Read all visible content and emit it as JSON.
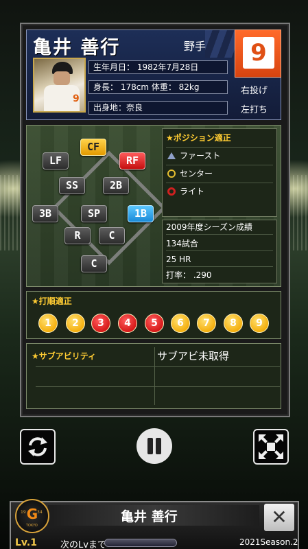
{
  "player": {
    "name": "亀井 善行",
    "position": "野手",
    "number": "9",
    "throws": "右投げ",
    "bats": "左打ち",
    "birthday": "生年月日： 1982年7月28日",
    "body": "身長： 178cm 体重： 82kg",
    "hometown": "出身地：奈良"
  },
  "field_positions": {
    "cf": "CF",
    "lf": "LF",
    "rf": "RF",
    "ss": "SS",
    "b2": "2B",
    "b3": "3B",
    "sp": "SP",
    "b1": "1B",
    "rp": "R",
    "cp": "C",
    "c": "C"
  },
  "aptitude": {
    "title": "★ポジション適正",
    "items": [
      {
        "mark": "triangle-icon",
        "label": "ファースト"
      },
      {
        "mark": "circle-yellow-icon",
        "label": "センター"
      },
      {
        "mark": "circle-red-icon",
        "label": "ライト"
      }
    ]
  },
  "season": {
    "title": "2009年度シーズン成績",
    "games": "134試合",
    "hr": "25 HR",
    "avg": "打率： .290"
  },
  "batting_order": {
    "title": "★打順適正",
    "slots": [
      {
        "label": "1",
        "color": "yellow"
      },
      {
        "label": "2",
        "color": "yellow"
      },
      {
        "label": "3",
        "color": "red"
      },
      {
        "label": "4",
        "color": "red"
      },
      {
        "label": "5",
        "color": "red"
      },
      {
        "label": "6",
        "color": "yellow"
      },
      {
        "label": "7",
        "color": "yellow"
      },
      {
        "label": "8",
        "color": "yellow"
      },
      {
        "label": "9",
        "color": "yellow"
      }
    ]
  },
  "sub_ability": {
    "title": "★サブアビリティ",
    "value": "サブアビ未取得"
  },
  "controls": {
    "refresh": "refresh-icon",
    "pause": "pause-icon",
    "fullscreen": "fullscreen-icon"
  },
  "bottom": {
    "name": "亀井 善行",
    "logo_g": "G",
    "logo_year_left": "19",
    "logo_year_right": "34",
    "logo_city": "TOKYO",
    "close": "✕",
    "level": "Lv.1",
    "next_level": "次のLvまで",
    "season": "2021Season.2"
  },
  "colors": {
    "accent": "#ffcc33",
    "number_bg": "#e05015",
    "header_bg": "#1d2e57"
  }
}
